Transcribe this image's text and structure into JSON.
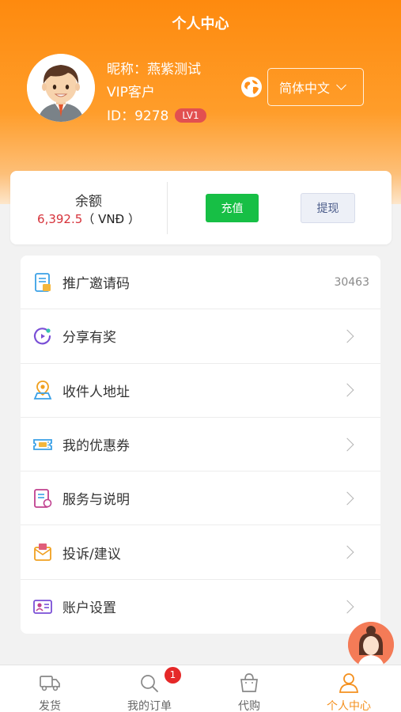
{
  "header": {
    "title": "个人中心"
  },
  "profile": {
    "nickname": "昵称：燕紫测试",
    "level_name": "VIP客户",
    "id_text": "ID：9278",
    "lv_badge": "LV1"
  },
  "language": {
    "selected": "简体中文"
  },
  "balance": {
    "label": "余额",
    "amount": "6,392.5",
    "currency": "（ VNĐ ）",
    "recharge_label": "充值",
    "withdraw_label": "提现"
  },
  "menu": {
    "items": [
      {
        "label": "推广邀请码",
        "value": "30463",
        "icon": "invite-code-icon"
      },
      {
        "label": "分享有奖",
        "icon": "share-reward-icon"
      },
      {
        "label": "收件人地址",
        "icon": "address-pin-icon"
      },
      {
        "label": "我的优惠券",
        "icon": "coupon-icon"
      },
      {
        "label": "服务与说明",
        "icon": "service-doc-icon"
      },
      {
        "label": "投诉/建议",
        "icon": "complaint-icon"
      },
      {
        "label": "账户设置",
        "icon": "account-card-icon"
      }
    ]
  },
  "tabbar": {
    "tabs": [
      {
        "label": "发货",
        "icon": "truck-icon"
      },
      {
        "label": "我的订单",
        "icon": "order-search-icon",
        "badge": "1"
      },
      {
        "label": "代购",
        "icon": "shopping-bag-icon"
      },
      {
        "label": "个人中心",
        "icon": "person-icon",
        "active": true
      }
    ]
  },
  "colors": {
    "brand_orange": "#fe8a0e",
    "recharge_green": "#17bf45",
    "price_red": "#d6323a",
    "active_tab": "#f4901e"
  }
}
